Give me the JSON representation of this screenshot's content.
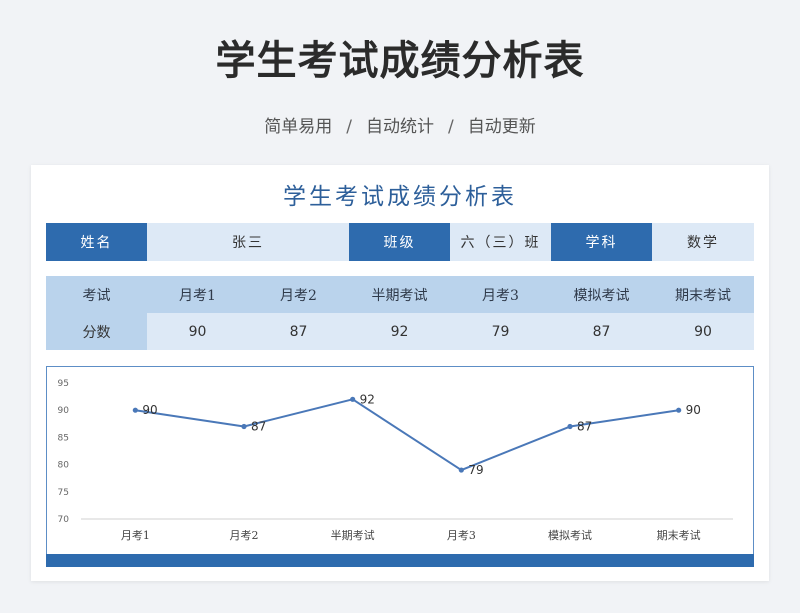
{
  "header": {
    "title": "学生考试成绩分析表",
    "tags": [
      "简单易用",
      "自动统计",
      "自动更新"
    ],
    "separator": "/"
  },
  "sheet": {
    "title": "学生考试成绩分析表",
    "info": {
      "name_label": "姓名",
      "name_value": "张三",
      "class_label": "班级",
      "class_value": "六（三）班",
      "subject_label": "学科",
      "subject_value": "数学"
    },
    "table": {
      "row_label_exam": "考试",
      "row_label_score": "分数",
      "exams": [
        "月考1",
        "月考2",
        "半期考试",
        "月考3",
        "模拟考试",
        "期末考试"
      ],
      "scores": [
        "90",
        "87",
        "92",
        "79",
        "87",
        "90"
      ]
    }
  },
  "colors": {
    "primary": "#2e6bae",
    "light": "#dde9f6",
    "mid": "#bad3ec",
    "line": "#4a78b8"
  },
  "chart_data": {
    "type": "line",
    "categories": [
      "月考1",
      "月考2",
      "半期考试",
      "月考3",
      "模拟考试",
      "期末考试"
    ],
    "series": [
      {
        "values": [
          90,
          87,
          92,
          79,
          87,
          90
        ]
      }
    ],
    "ylim": [
      70,
      95
    ],
    "yticks": [
      70,
      75,
      80,
      85,
      90,
      95
    ],
    "grid": false,
    "data_labels": true
  }
}
